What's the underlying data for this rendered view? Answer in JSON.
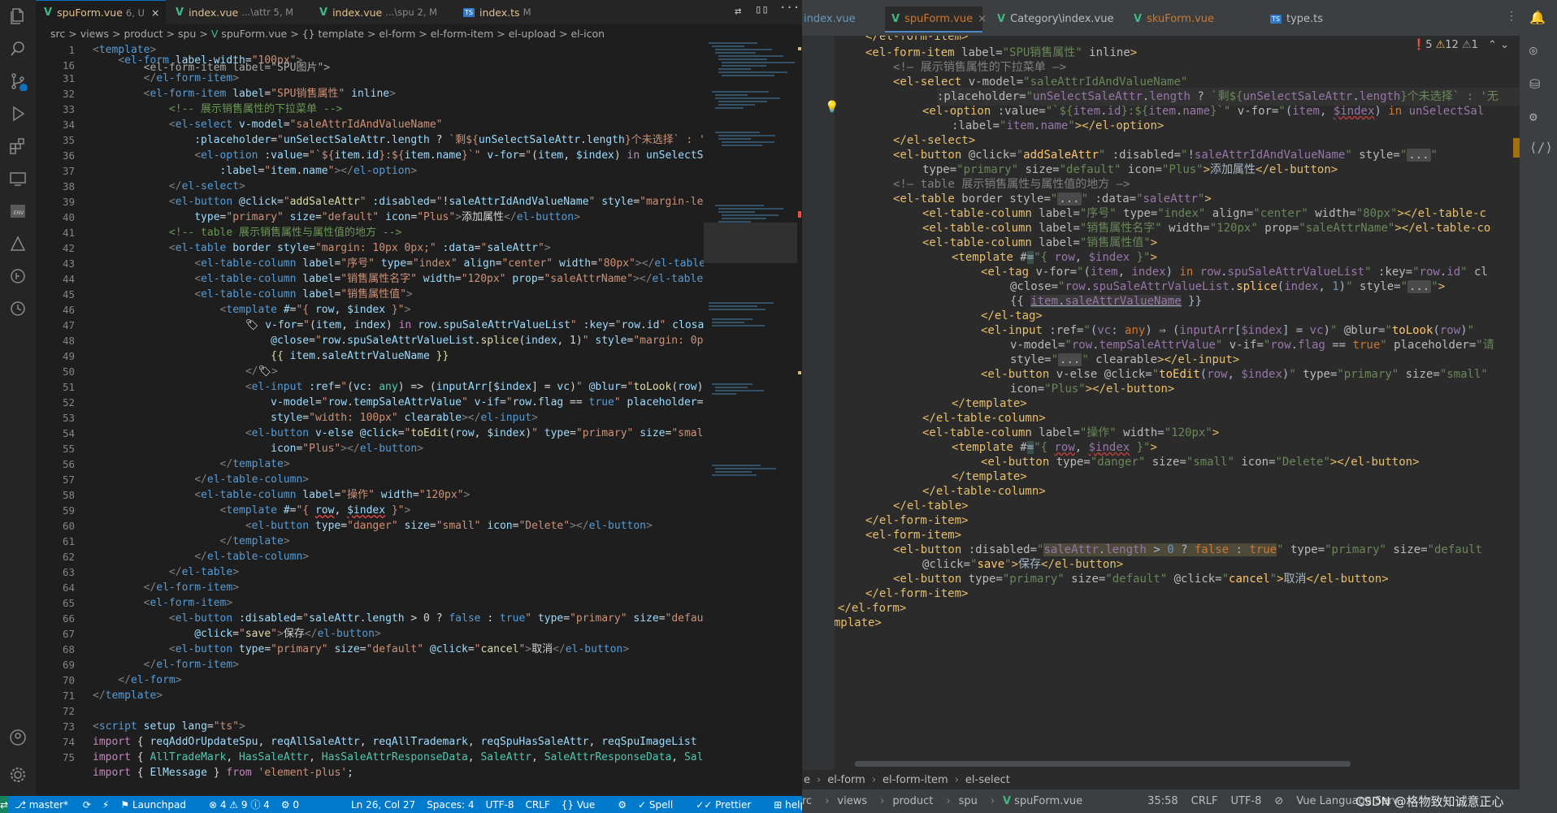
{
  "left": {
    "tabs": [
      {
        "name": "spuForm.vue",
        "status": "6, U"
      },
      {
        "name": "index.vue",
        "status": "...\\attr 5, M"
      },
      {
        "name": "index.vue",
        "status": "...\\spu 2, M"
      },
      {
        "name": "index.ts",
        "status": "M"
      }
    ],
    "breadcrumb": [
      "src",
      ">",
      "views",
      ">",
      "product",
      ">",
      "spu",
      ">",
      "spuForm.vue",
      ">",
      "{} template",
      ">",
      "el-form",
      ">",
      "el-form-item",
      ">",
      "el-upload",
      ">",
      "el-icon"
    ],
    "line_numbers": [
      "1",
      "16",
      "31",
      "32",
      "33",
      "34",
      "35",
      "36",
      "37",
      "38",
      "39",
      "40",
      "41",
      "42",
      "43",
      "44",
      "45",
      "46",
      "47",
      "48",
      "49",
      "50",
      "51",
      "52",
      "53",
      "54",
      "55",
      "56",
      "57",
      "58",
      "59",
      "60",
      "61",
      "62",
      "63",
      "64",
      "65",
      "66",
      "67",
      "68",
      "69",
      "70",
      "71",
      "72",
      "73",
      "74",
      "75"
    ],
    "status": {
      "branch": "master*",
      "launchpad": "Launchpad",
      "problems": "⊗ 4 ⚠ 9 ⓘ 4",
      "ports": "⚙ 0",
      "position": "Ln 26, Col 27",
      "spaces": "Spaces: 4",
      "encoding": "UTF-8",
      "eol": "CRLF",
      "language": "Vue",
      "spell": "Spell",
      "prettier": "Prettier",
      "helper": "helper"
    }
  },
  "right": {
    "tabs": [
      "index.vue",
      "spuForm.vue",
      "Category\\index.vue",
      "skuForm.vue",
      "type.ts"
    ],
    "inspections": {
      "errors": "5",
      "warnings": "12",
      "weak": "1"
    },
    "bottom_breadcrumb": [
      "e",
      "el-form",
      "el-form-item",
      "el-select"
    ],
    "status": {
      "path": [
        "rc",
        "views",
        "product",
        "spu",
        "spuForm.vue"
      ],
      "position": "35:58",
      "eol": "CRLF",
      "encoding": "UTF-8",
      "language": "Vue Language Serv",
      "watermark": "CSDN @格物致知诚意正心"
    }
  },
  "colors": {
    "status_bar": "#007acc",
    "jb_bg": "#2b2b2b",
    "vsc_bg": "#1e1e1e"
  }
}
